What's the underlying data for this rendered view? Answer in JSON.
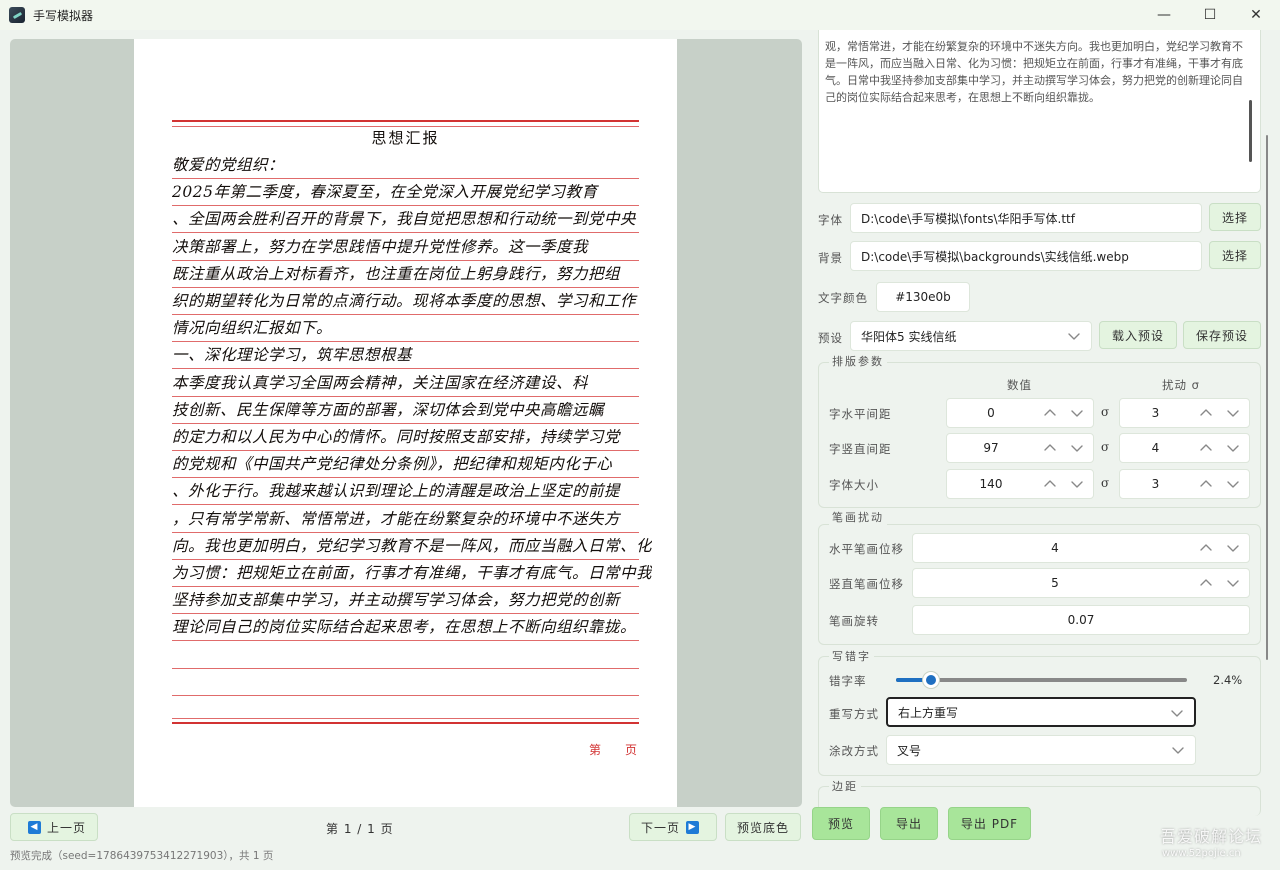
{
  "window": {
    "title": "手写模拟器",
    "minimize": "—",
    "maximize": "☐",
    "close": "✕"
  },
  "paper": {
    "title": "思想汇报",
    "lines": [
      "敬爱的党组织：",
      "    2025年第二季度，春深夏至，在全党深入开展党纪学习教育",
      "、全国两会胜利召开的背景下，我自觉把思想和行动统一到党中央",
      "决策部署上，努力在学思践悟中提升党性修养。这一季度我",
      "既注重从政治上对标看齐，也注重在岗位上躬身践行，努力把组",
      "织的期望转化为日常的点滴行动。现将本季度的思想、学习和工作",
      "情况向组织汇报如下。",
      "一、深化理论学习，筑牢思想根基",
      "    本季度我认真学习全国两会精神，关注国家在经济建设、科",
      "技创新、民生保障等方面的部署，深切体会到党中央高瞻远瞩",
      "的定力和以人民为中心的情怀。同时按照支部安排，持续学习党",
      "的党规和《中国共产党纪律处分条例》，把纪律和规矩内化于心",
      "、外化于行。我越来越认识到理论上的清醒是政治上坚定的前提",
      "，只有常学常新、常悟常进，才能在纷繁复杂的环境中不迷失方",
      "向。我也更加明白，党纪学习教育不是一阵风，而应当融入日常、化",
      "为习惯：把规矩立在前面，行事才有准绳，干事才有底气。日常中我",
      "坚持参加支部集中学习，并主动撰写学习体会，努力把党的创新",
      "理论同自己的岗位实际结合起来思考，在思想上不断向组织靠拢。"
    ],
    "page_label": "第页"
  },
  "text_input": {
    "content": "观，常悟常进，才能在纷繁复杂的环境中不迷失方向。我也更加明白，党纪学习教育不是一阵风，而应当融入日常、化为习惯：把规矩立在前面，行事才有准绳，干事才有底气。日常中我坚持参加支部集中学习，并主动撰写学习体会，努力把党的创新理论同自己的岗位实际结合起来思考，在思想上不断向组织靠拢。"
  },
  "font": {
    "label": "字体",
    "value": "D:\\code\\手写模拟\\fonts\\华阳手写体.ttf",
    "button": "选择"
  },
  "background": {
    "label": "背景",
    "value": "D:\\code\\手写模拟\\backgrounds\\实线信纸.webp",
    "button": "选择"
  },
  "text_color": {
    "label": "文字颜色",
    "value": "#130e0b"
  },
  "preset": {
    "label": "预设",
    "value": "华阳体5 实线信纸",
    "load_button": "载入预设",
    "save_button": "保存预设"
  },
  "layout_params": {
    "title": "排版参数",
    "col_value": "数值",
    "col_jitter": "扰动 σ",
    "sigma": "σ",
    "rows": [
      {
        "label": "字水平间距",
        "value": "0",
        "jitter": "3"
      },
      {
        "label": "字竖直间距",
        "value": "97",
        "jitter": "4"
      },
      {
        "label": "字体大小",
        "value": "140",
        "jitter": "3"
      }
    ]
  },
  "stroke_jitter": {
    "title": "笔画扰动",
    "rows": [
      {
        "label": "水平笔画位移",
        "value": "4"
      },
      {
        "label": "竖直笔画位移",
        "value": "5"
      },
      {
        "label": "笔画旋转",
        "value": "0.07"
      }
    ]
  },
  "typo": {
    "title": "写错字",
    "rate_label": "错字率",
    "rate_value": "2.4%",
    "rate_fraction": 0.024,
    "rewrite_label": "重写方式",
    "rewrite_value": "右上方重写",
    "strike_label": "涂改方式",
    "strike_value": "叉号"
  },
  "margin": {
    "title": "边距"
  },
  "bottom": {
    "prev_page": "上一页",
    "page_indicator": "第 1 / 1 页",
    "next_page": "下一页",
    "preview_bg": "预览底色",
    "preview": "预览",
    "export": "导出",
    "export_pdf": "导出 PDF",
    "status": "预览完成（seed=1786439753412271903），共 1 页"
  },
  "watermark": {
    "line1": "吾爱破解论坛",
    "line2": "www.52pojie.cn"
  },
  "colors": {
    "accent": "#1e6fc1",
    "green_button": "#a8e59a",
    "paper_line": "#d23333",
    "ink": "#130e0b"
  }
}
